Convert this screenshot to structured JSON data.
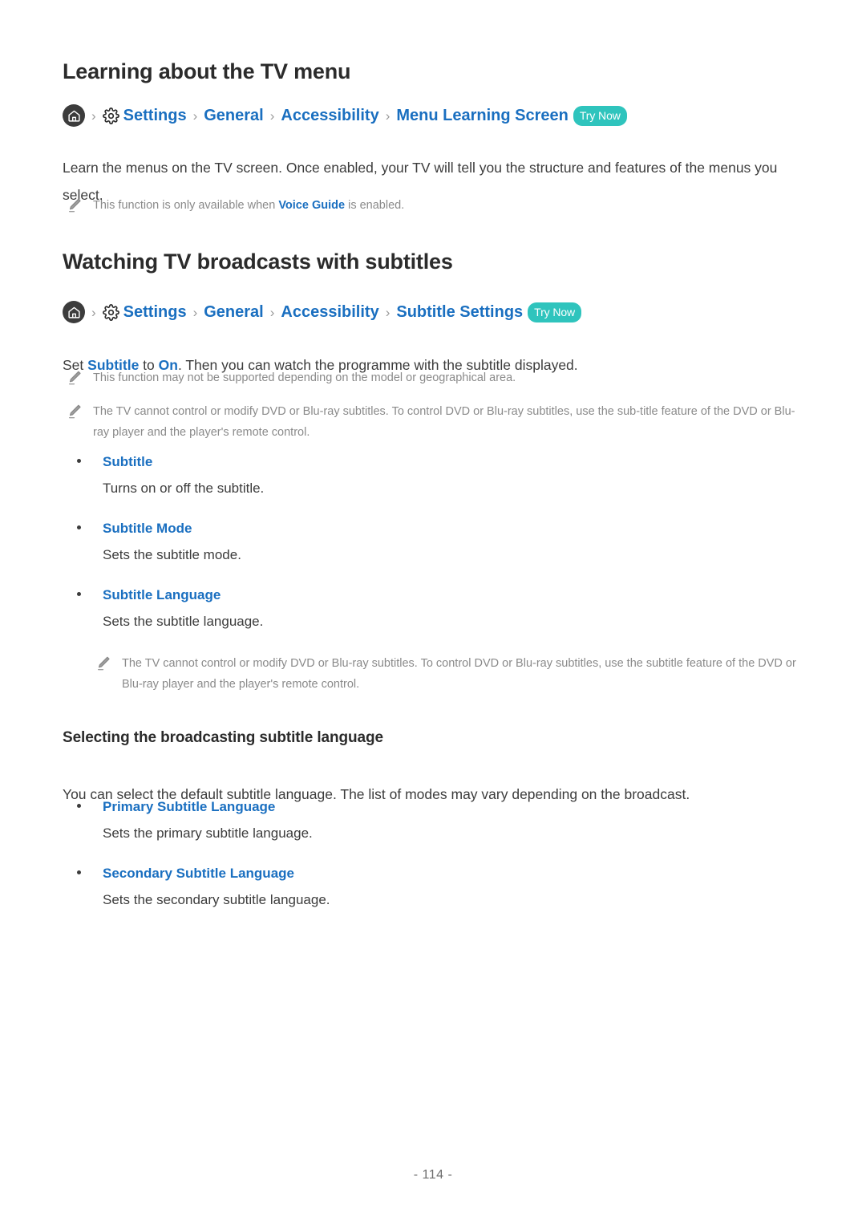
{
  "page": {
    "number_label": "- 114 -"
  },
  "colors": {
    "link_blue": "#1a6fc0",
    "badge_teal": "#2fc4bd",
    "body_text": "#3c3c3c",
    "note_text": "#8a8a8a",
    "heading": "#2b2b2b"
  },
  "sections": [
    {
      "title": "Learning about the TV menu",
      "breadcrumb": {
        "home_icon": "home-icon",
        "gear_icon": "gear-icon",
        "separator": "›",
        "items": [
          "Settings",
          "General",
          "Accessibility",
          "Menu Learning Screen"
        ],
        "badge": "Try Now"
      },
      "paragraph": {
        "text": "Learn the menus on the TV screen. Once enabled, your TV will tell you the structure and features of the menus you select."
      },
      "notes": [
        {
          "icon": "pencil-icon",
          "before": "This function is only available when ",
          "link": "Voice Guide",
          "after": " is enabled."
        }
      ]
    },
    {
      "title": "Watching TV broadcasts with subtitles",
      "breadcrumb": {
        "home_icon": "home-icon",
        "gear_icon": "gear-icon",
        "separator": "›",
        "items": [
          "Settings",
          "General",
          "Accessibility",
          "Subtitle Settings"
        ],
        "badge": "Try Now"
      },
      "paragraph": {
        "part1": "Set ",
        "link1": "Subtitle",
        "part2": " to ",
        "link2": "On",
        "part3": ". Then you can watch the programme with the subtitle displayed."
      },
      "notes": [
        {
          "icon": "pencil-icon",
          "text": "This function may not be supported depending on the model or geographical area."
        },
        {
          "icon": "pencil-icon",
          "text": "The TV cannot control or modify DVD or Blu-ray subtitles. To control DVD or Blu-ray subtitles, use the sub-title feature of the DVD or Blu-ray player and the player's remote control."
        }
      ],
      "bullets": [
        {
          "label": "Subtitle",
          "description": "Turns on or off the subtitle."
        },
        {
          "label": "Subtitle Mode",
          "description": "Sets the subtitle mode."
        },
        {
          "label": "Subtitle Language",
          "description": "Sets the subtitle language."
        }
      ],
      "indented_note": {
        "icon": "pencil-icon",
        "text": "The TV cannot control or modify DVD or Blu-ray subtitles. To control DVD or Blu-ray subtitles, use the subtitle feature of the DVD or Blu-ray player and the player's remote control."
      },
      "subsection": {
        "title": "Selecting the broadcasting subtitle language",
        "paragraph": "You can select the default subtitle language. The list of modes may vary depending on the broadcast.",
        "bullets": [
          {
            "label": "Primary Subtitle Language",
            "description": "Sets the primary subtitle language."
          },
          {
            "label": "Secondary Subtitle Language",
            "description": "Sets the secondary subtitle language."
          }
        ]
      }
    }
  ]
}
